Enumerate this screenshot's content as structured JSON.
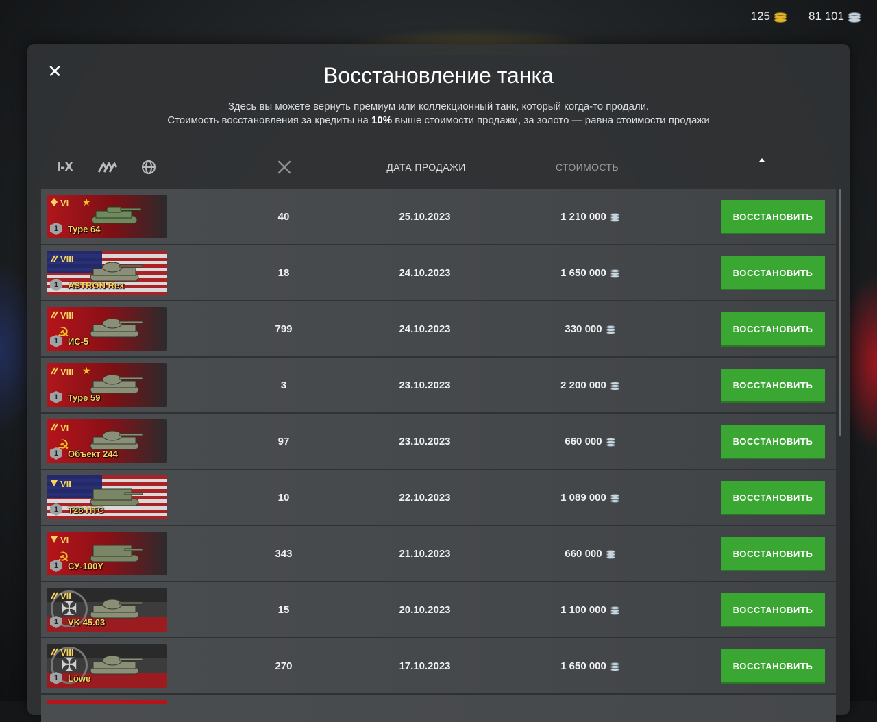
{
  "currency": {
    "gold": "125",
    "credits": "81 101"
  },
  "dialog": {
    "title": "Восстановление танка",
    "description_line1": "Здесь вы можете вернуть премиум или коллекционный танк, который когда-то продали.",
    "description_line2_pre": "Стоимость восстановления за кредиты на ",
    "description_line2_bold": "10%",
    "description_line2_post": " выше стоимости продажи, за золото — равна стоимости продажи"
  },
  "filters": {
    "tier_label": "I-X",
    "icons": [
      "tier-filter-icon",
      "type-filter-icon",
      "nation-globe-icon",
      "battles-swords-icon"
    ]
  },
  "columns": {
    "date": "ДАТА ПРОДАЖИ",
    "cost": "СТОИМОСТЬ",
    "sort": "ascending-arrow"
  },
  "rows": [
    {
      "tier": "VI",
      "name": "Type 64",
      "nation": "china",
      "type_icon": "light-tank",
      "battles": "40",
      "date": "25.10.2023",
      "cost": "1 210 000",
      "mastery": "1",
      "button": "ВОССТАНОВИТЬ"
    },
    {
      "tier": "VIII",
      "name": "ASTRON Rex",
      "nation": "usa",
      "type_icon": "medium-tank",
      "battles": "18",
      "date": "24.10.2023",
      "cost": "1 650 000",
      "mastery": "1",
      "button": "ВОССТАНОВИТЬ"
    },
    {
      "tier": "VIII",
      "name": "ИС-5",
      "nation": "ussr",
      "type_icon": "medium-tank",
      "battles": "799",
      "date": "24.10.2023",
      "cost": "330 000",
      "mastery": "1",
      "button": "ВОССТАНОВИТЬ"
    },
    {
      "tier": "VIII",
      "name": "Type 59",
      "nation": "china",
      "type_icon": "medium-tank",
      "battles": "3",
      "date": "23.10.2023",
      "cost": "2 200 000",
      "mastery": "1",
      "button": "ВОССТАНОВИТЬ"
    },
    {
      "tier": "VI",
      "name": "Объект 244",
      "nation": "ussr",
      "type_icon": "medium-tank",
      "battles": "97",
      "date": "23.10.2023",
      "cost": "660 000",
      "mastery": "1",
      "button": "ВОССТАНОВИТЬ"
    },
    {
      "tier": "VII",
      "name": "T28 HTC",
      "nation": "usa",
      "type_icon": "tank-destroyer",
      "battles": "10",
      "date": "22.10.2023",
      "cost": "1 089 000",
      "mastery": "1",
      "button": "ВОССТАНОВИТЬ"
    },
    {
      "tier": "VI",
      "name": "СУ-100Y",
      "nation": "ussr",
      "type_icon": "tank-destroyer",
      "battles": "343",
      "date": "21.10.2023",
      "cost": "660 000",
      "mastery": "1",
      "button": "ВОССТАНОВИТЬ"
    },
    {
      "tier": "VII",
      "name": "VK 45.03",
      "nation": "germany",
      "type_icon": "medium-tank",
      "battles": "15",
      "date": "20.10.2023",
      "cost": "1 100 000",
      "mastery": "1",
      "button": "ВОССТАНОВИТЬ"
    },
    {
      "tier": "VIII",
      "name": "Löwe",
      "nation": "germany",
      "type_icon": "medium-tank",
      "battles": "270",
      "date": "17.10.2023",
      "cost": "1 650 000",
      "mastery": "1",
      "button": "ВОССТАНОВИТЬ"
    }
  ]
}
